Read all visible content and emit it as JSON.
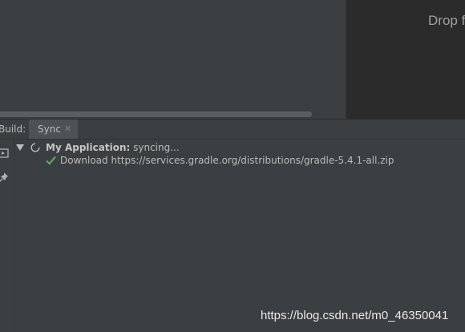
{
  "editor": {
    "drop_text": "Drop f"
  },
  "build_window": {
    "build_label": "Build:",
    "tabs": [
      {
        "label": "Sync",
        "closable": true,
        "active": true
      }
    ],
    "tree": {
      "root": {
        "title": "My Application:",
        "status": "syncing...",
        "expanded": true,
        "icon": "spinner-icon"
      },
      "children": [
        {
          "text": "Download https://services.gradle.org/distributions/gradle-5.4.1-all.zip",
          "icon": "check-icon"
        }
      ]
    }
  },
  "watermark": "https://blog.csdn.net/m0_46350041",
  "colors": {
    "background": "#3c3f41",
    "drop_panel": "#2b2b2b",
    "check": "#59a869",
    "text": "#bbbbbb"
  }
}
